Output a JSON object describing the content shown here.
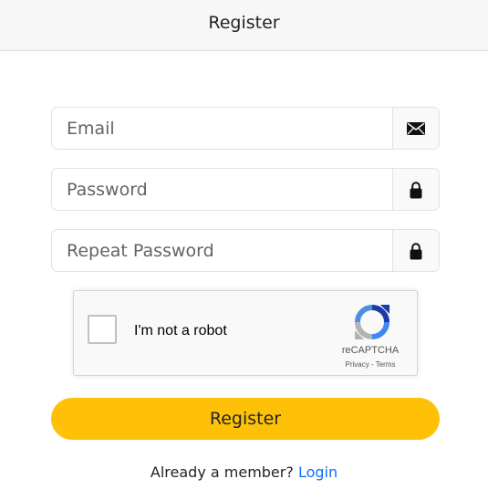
{
  "header": {
    "title": "Register"
  },
  "form": {
    "email": {
      "placeholder": "Email",
      "value": "",
      "icon": "envelope-icon"
    },
    "password": {
      "placeholder": "Password",
      "value": "",
      "icon": "lock-icon"
    },
    "repeat_password": {
      "placeholder": "Repeat Password",
      "value": "",
      "icon": "lock-icon"
    }
  },
  "captcha": {
    "label": "I'm not a robot",
    "brand": "reCAPTCHA",
    "privacy": "Privacy",
    "separator": " - ",
    "terms": "Terms"
  },
  "register_button": {
    "label": "Register",
    "color": "#ffc107"
  },
  "footer": {
    "prompt": "Already a member?",
    "login_link": "Login",
    "link_color": "#0d6efd"
  }
}
